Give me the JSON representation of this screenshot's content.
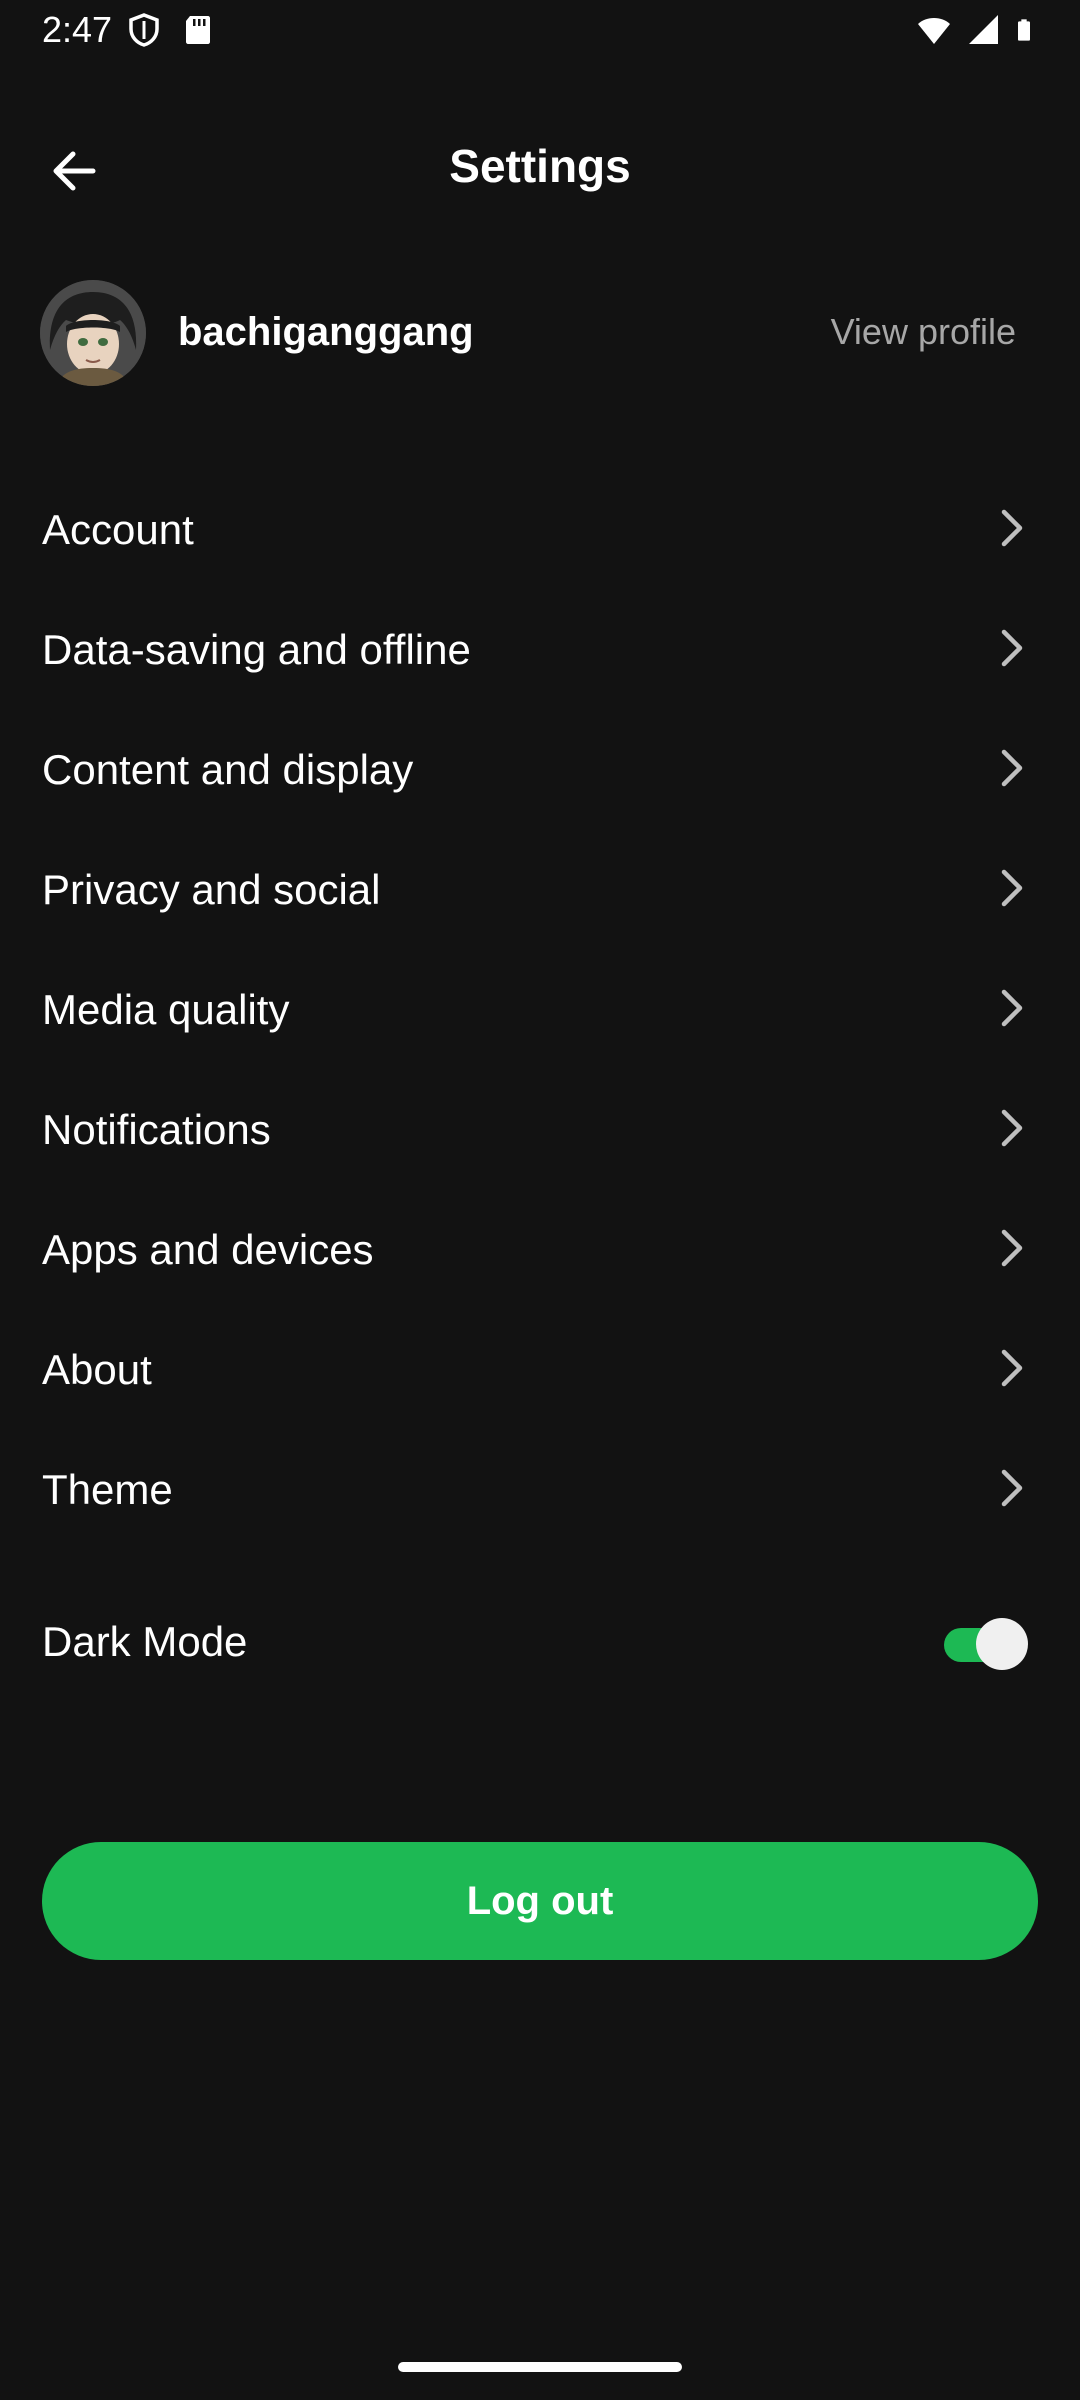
{
  "status_bar": {
    "time": "2:47",
    "icons": [
      "shield-icon",
      "sd-card-icon",
      "wifi-icon",
      "signal-icon",
      "battery-icon"
    ]
  },
  "header": {
    "title": "Settings",
    "back_icon": "arrow-left-icon"
  },
  "profile": {
    "username": "bachiganggang",
    "view_profile_label": "View profile",
    "avatar_icon": "avatar-image"
  },
  "menu": {
    "items": [
      {
        "label": "Account"
      },
      {
        "label": "Data-saving and offline"
      },
      {
        "label": "Content and display"
      },
      {
        "label": "Privacy and social"
      },
      {
        "label": "Media quality"
      },
      {
        "label": "Notifications"
      },
      {
        "label": "Apps and devices"
      },
      {
        "label": "About"
      },
      {
        "label": "Theme"
      }
    ]
  },
  "dark_mode": {
    "label": "Dark Mode",
    "enabled": true
  },
  "logout": {
    "label": "Log out"
  },
  "colors": {
    "background": "#121212",
    "accent": "#1db954",
    "secondary_text": "#a7a7a7"
  }
}
